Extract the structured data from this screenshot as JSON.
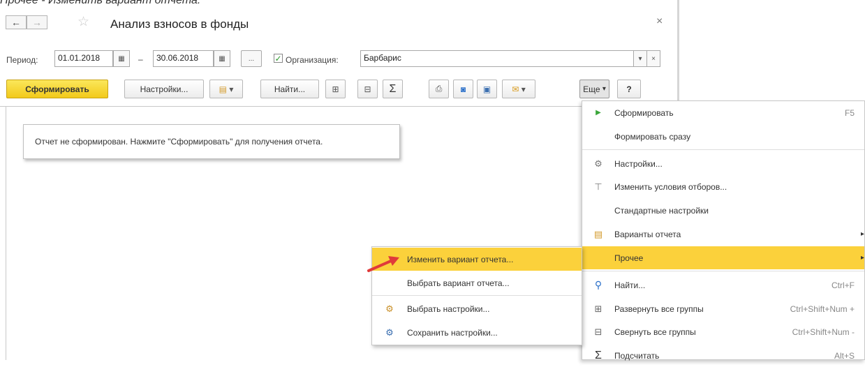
{
  "caption": "Прочее - Изменить вариант отчета.",
  "window": {
    "title": "Анализ взносов в фонды",
    "back_icon": "←",
    "forward_icon": "→",
    "star_icon": "☆",
    "close_icon": "×"
  },
  "period": {
    "label": "Период:",
    "from": "01.01.2018",
    "dash": "–",
    "to": "30.06.2018",
    "calendar_icon": "▦",
    "more_button": "..."
  },
  "organization": {
    "checkbox_checked": true,
    "check_mark": "✓",
    "label": "Организация:",
    "value": "Барбарис",
    "dropdown_icon": "▾",
    "clear_icon": "×"
  },
  "toolbar": {
    "generate": "Сформировать",
    "settings": "Настройки...",
    "find": "Найти...",
    "more": "Еще",
    "more_arrow": "▾",
    "help": "?",
    "variants_arrow": "▾",
    "sum_icon": "Σ",
    "email_arrow": "▾"
  },
  "notice": "Отчет не сформирован. Нажмите \"Сформировать\" для получения отчета.",
  "menu": {
    "items": [
      {
        "label": "Сформировать",
        "shortcut": "F5",
        "icon": "▶"
      },
      {
        "label": "Формировать сразу",
        "shortcut": "",
        "icon": ""
      },
      {
        "label": "Настройки...",
        "shortcut": "",
        "icon": "⚙"
      },
      {
        "label": "Изменить условия отборов...",
        "shortcut": "",
        "icon": "⊤"
      },
      {
        "label": "Стандартные настройки",
        "shortcut": "",
        "icon": ""
      },
      {
        "label": "Варианты отчета",
        "shortcut": "",
        "icon": "▤",
        "submenu_arrow": "▸"
      },
      {
        "label": "Прочее",
        "shortcut": "",
        "icon": "",
        "submenu_arrow": "▸"
      },
      {
        "label": "Найти...",
        "shortcut": "Ctrl+F",
        "icon": "🔍"
      },
      {
        "label": "Развернуть все группы",
        "shortcut": "Ctrl+Shift+Num +",
        "icon": "⊞"
      },
      {
        "label": "Свернуть все группы",
        "shortcut": "Ctrl+Shift+Num -",
        "icon": "⊟"
      },
      {
        "label": "Подсчитать",
        "shortcut": "Alt+S",
        "icon": "Σ"
      }
    ]
  },
  "submenu": {
    "items": [
      {
        "label": "Изменить вариант отчета...",
        "icon": ""
      },
      {
        "label": "Выбрать вариант отчета...",
        "icon": ""
      },
      {
        "label": "Выбрать настройки...",
        "icon": "⚙"
      },
      {
        "label": "Сохранить настройки...",
        "icon": "⚙"
      }
    ]
  },
  "colors": {
    "accent_yellow": "#fbd13b",
    "primary_button": "#f2c91a",
    "play_green": "#3aa63a",
    "arrow_red": "#e03a3a",
    "search_blue": "#2a6fc9"
  }
}
